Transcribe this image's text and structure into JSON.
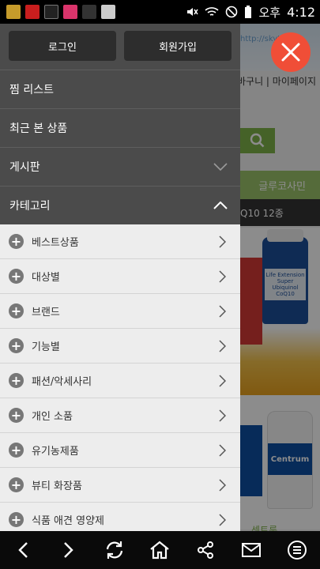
{
  "statusbar": {
    "time": "4:12",
    "ampm": "오후"
  },
  "page": {
    "user_links": "바구니 | 마이페이지",
    "url_hint": "http://skyt",
    "green_tab": "글루코사민",
    "dark_strip": "Q10 12종",
    "bottle1_label": "Life Extension Super Ubiquinol CoQ10",
    "bottle2_label": "Centrum",
    "bottom_text": "센트룸"
  },
  "drawer": {
    "login": "로그인",
    "signup": "회원가입",
    "menu": [
      {
        "label": "찜 리스트",
        "chevron": ""
      },
      {
        "label": "최근 본 상품",
        "chevron": ""
      },
      {
        "label": "게시판",
        "chevron": "down"
      },
      {
        "label": "카테고리",
        "chevron": "up"
      }
    ],
    "categories": [
      "베스트상품",
      "대상별",
      "브랜드",
      "기능별",
      "패션/악세사리",
      "개인 소품",
      "유기농제품",
      "뷰티 화장품",
      "식품 애견 영양제"
    ]
  },
  "colors": {
    "accent_close": "#f04e37",
    "green": "#7fb349"
  }
}
